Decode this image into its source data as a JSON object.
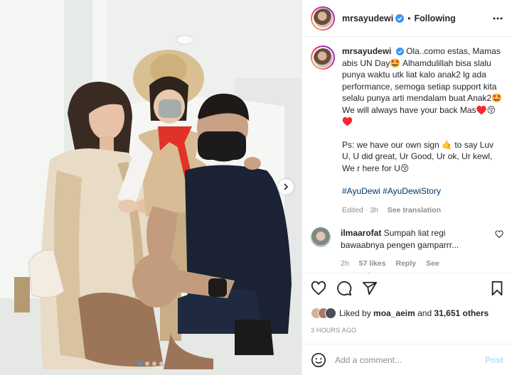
{
  "colors": {
    "accent": "#0095f6",
    "verified": "#3897f0",
    "muted": "#8e8e8e",
    "hashtag": "#00376b",
    "post_disabled": "#b2dffc"
  },
  "header": {
    "username": "mrsayudewi",
    "separator": "•",
    "follow_status": "Following"
  },
  "caption": {
    "username": "mrsayudewi",
    "text_1": "Ola..como estas, Mamas abis UN Day🤩 Alhamdulillah bisa slalu punya waktu utk liat kalo anak2 lg ada performance, semoga setiap support kita selalu punya arti mendalam buat Anak2🤩 We will always have your back Mas♥️😚♥️",
    "text_2": "Ps: we have our own sign 🤙 to say Luv U, U did great, Ur Good, Ur ok, Ur kewl, We r here for U😚",
    "hashtag_1": "#AyuDewi",
    "hashtag_2": "#AyuDewiStory",
    "edited": "Edited · 3h",
    "see_translation": "See translation"
  },
  "comment": {
    "username": "ilmaarofat",
    "text": "Sumpah liat regi bawaabnya pengen gamparrr...",
    "age": "2h",
    "likes": "57 likes",
    "reply": "Reply",
    "see_translation": "See translation"
  },
  "likes": {
    "prefix": "Liked by",
    "user": "moa_aeim",
    "and": "and",
    "count": "31,651 others"
  },
  "time_ago": "3 HOURS AGO",
  "add_comment": {
    "placeholder": "Add a comment...",
    "post_label": "Post"
  },
  "carousel": {
    "total": 4,
    "active": 1
  },
  "icons": [
    "verified-badge-icon",
    "more-options-icon",
    "heart-icon",
    "comment-icon",
    "share-icon",
    "bookmark-icon",
    "emoji-icon",
    "chevron-right-icon"
  ]
}
